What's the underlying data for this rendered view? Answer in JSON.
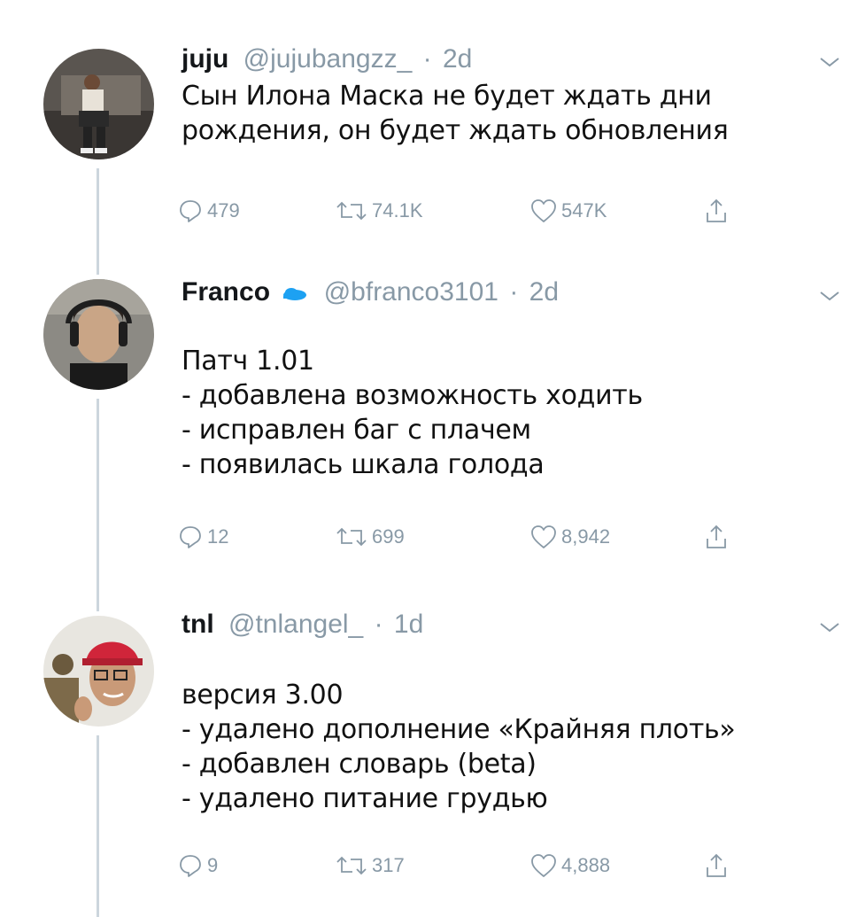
{
  "tweets": [
    {
      "name": "juju",
      "handle": "@jujubangzz_",
      "sep": "·",
      "time": "2d",
      "verified": false,
      "lines": [
        "Сын Илона Маска не будет ждать дни",
        "рождения, он будет ждать обновления"
      ],
      "reply_count": "479",
      "retweet_count": "74.1K",
      "like_count": "547K"
    },
    {
      "name": "Franco",
      "handle": "@bfranco3101",
      "sep": "·",
      "time": "2d",
      "verified": true,
      "lines": [
        "Патч 1.01",
        "- добавлена возможность ходить",
        "- исправлен баг с плачем",
        "- появилась шкала голода"
      ],
      "reply_count": "12",
      "retweet_count": "699",
      "like_count": "8,942"
    },
    {
      "name": "tnl",
      "handle": "@tnlangel_",
      "sep": "·",
      "time": "1d",
      "verified": false,
      "lines": [
        "версия 3.00",
        "- удалено дополнение «Крайняя плоть»",
        "- добавлен словарь (beta)",
        "- удалено питание грудью"
      ],
      "reply_count": "9",
      "retweet_count": "317",
      "like_count": "4,888"
    }
  ],
  "colors": {
    "muted": "#8899a6",
    "thread_line": "#ccd6dd",
    "verified_badge": "#1da1f2"
  },
  "icons": [
    "reply-icon",
    "retweet-icon",
    "like-icon",
    "share-icon",
    "chevron-down-icon",
    "verified-icon"
  ]
}
